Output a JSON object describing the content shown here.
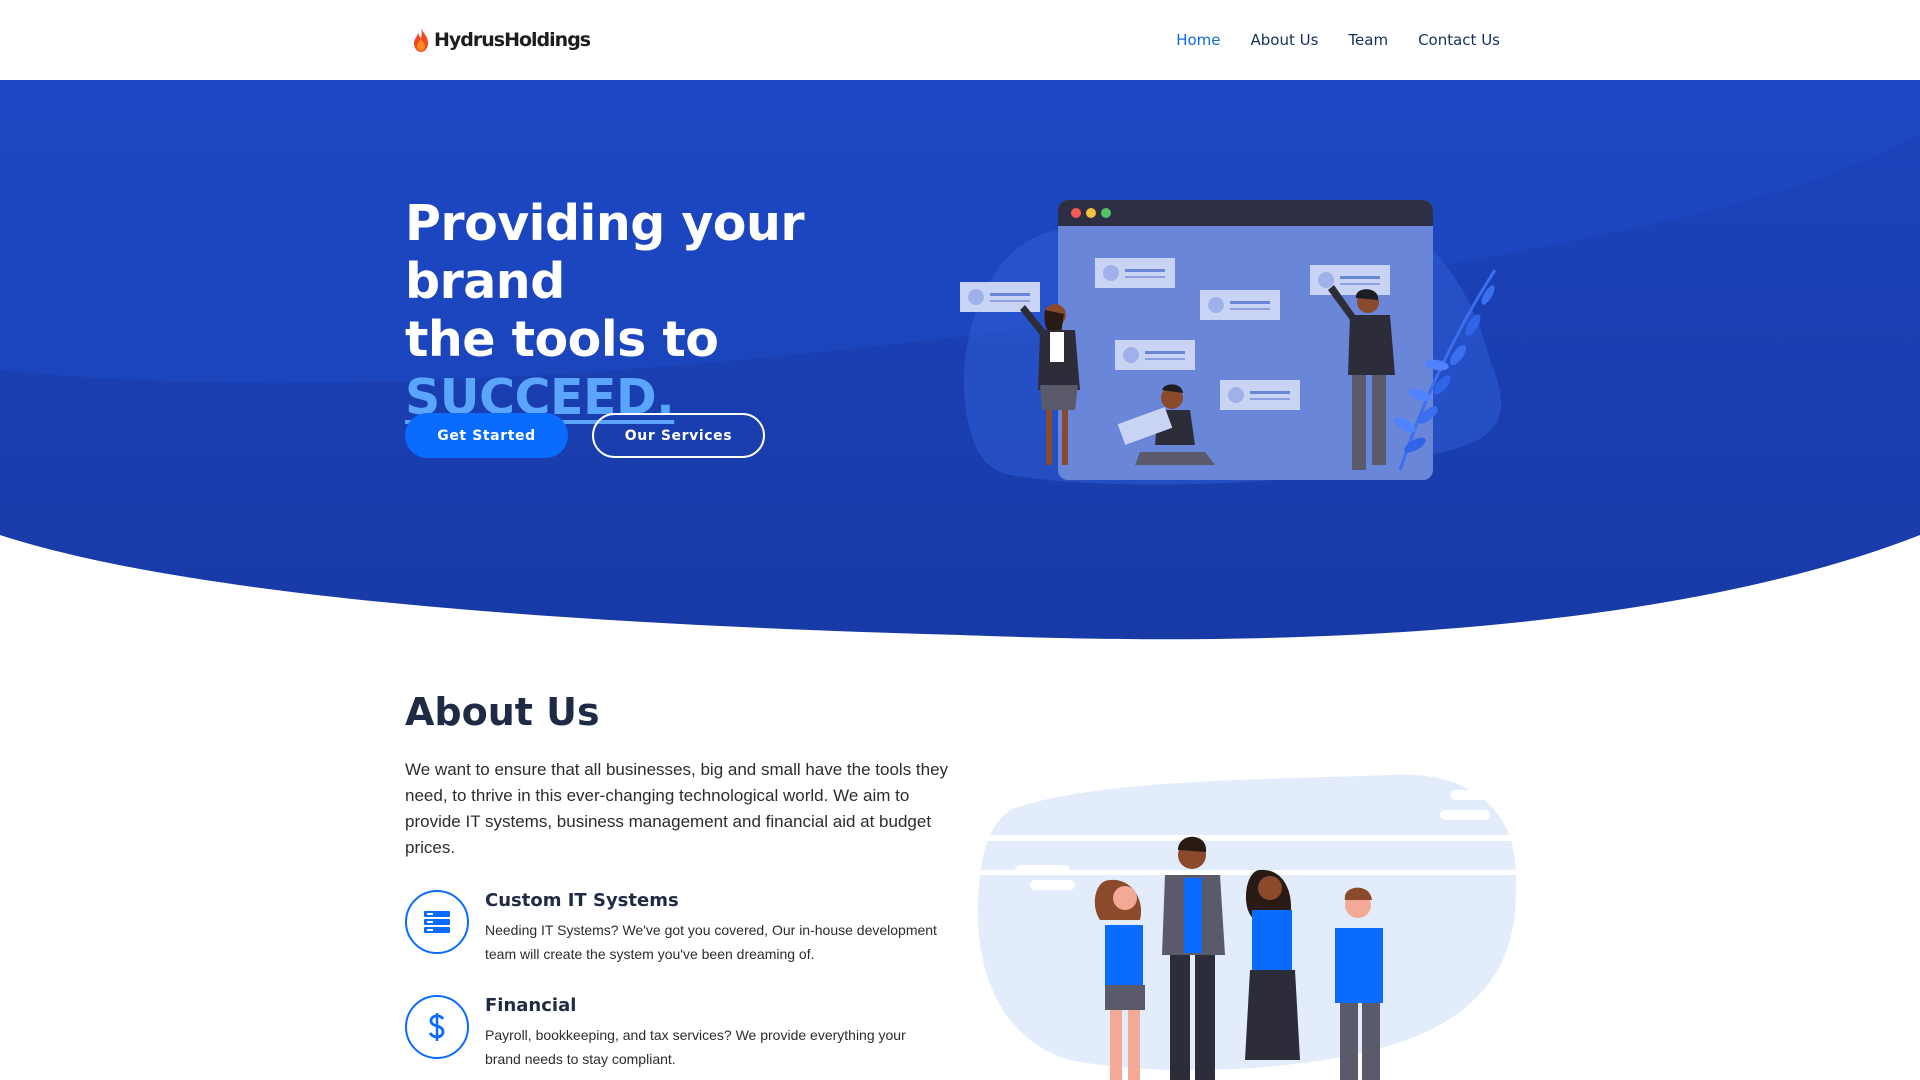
{
  "brand": {
    "name": "HydrusHoldings"
  },
  "nav": {
    "items": [
      {
        "label": "Home",
        "active": true
      },
      {
        "label": "About Us",
        "active": false
      },
      {
        "label": "Team",
        "active": false
      },
      {
        "label": "Contact Us",
        "active": false
      }
    ]
  },
  "hero": {
    "title_line1": "Providing your brand",
    "title_line2": "the tools to",
    "title_accent": "SUCCEED.",
    "primary_button": "Get Started",
    "secondary_button": "Our Services"
  },
  "about": {
    "title": "About Us",
    "text": "We want to ensure that all businesses, big and small have the tools they need, to thrive in this ever-changing technological world. We aim to provide IT systems, business management and financial aid at budget prices.",
    "features": [
      {
        "title": "Custom IT Systems",
        "description": "Needing IT Systems? We've got you covered, Our in-house development team will create the system you've been dreaming of.",
        "icon": "server-icon"
      },
      {
        "title": "Financial",
        "description": "Payroll, bookkeeping, and tax services? We provide everything your brand needs to stay compliant.",
        "icon": "dollar-icon"
      }
    ]
  },
  "colors": {
    "hero_bg": "#1a3fb5",
    "hero_dark": "#183aa6",
    "accent": "#0a6bff",
    "accent_light": "#5aa6ff",
    "nav_text": "#14305d",
    "heading": "#1f2a44"
  }
}
